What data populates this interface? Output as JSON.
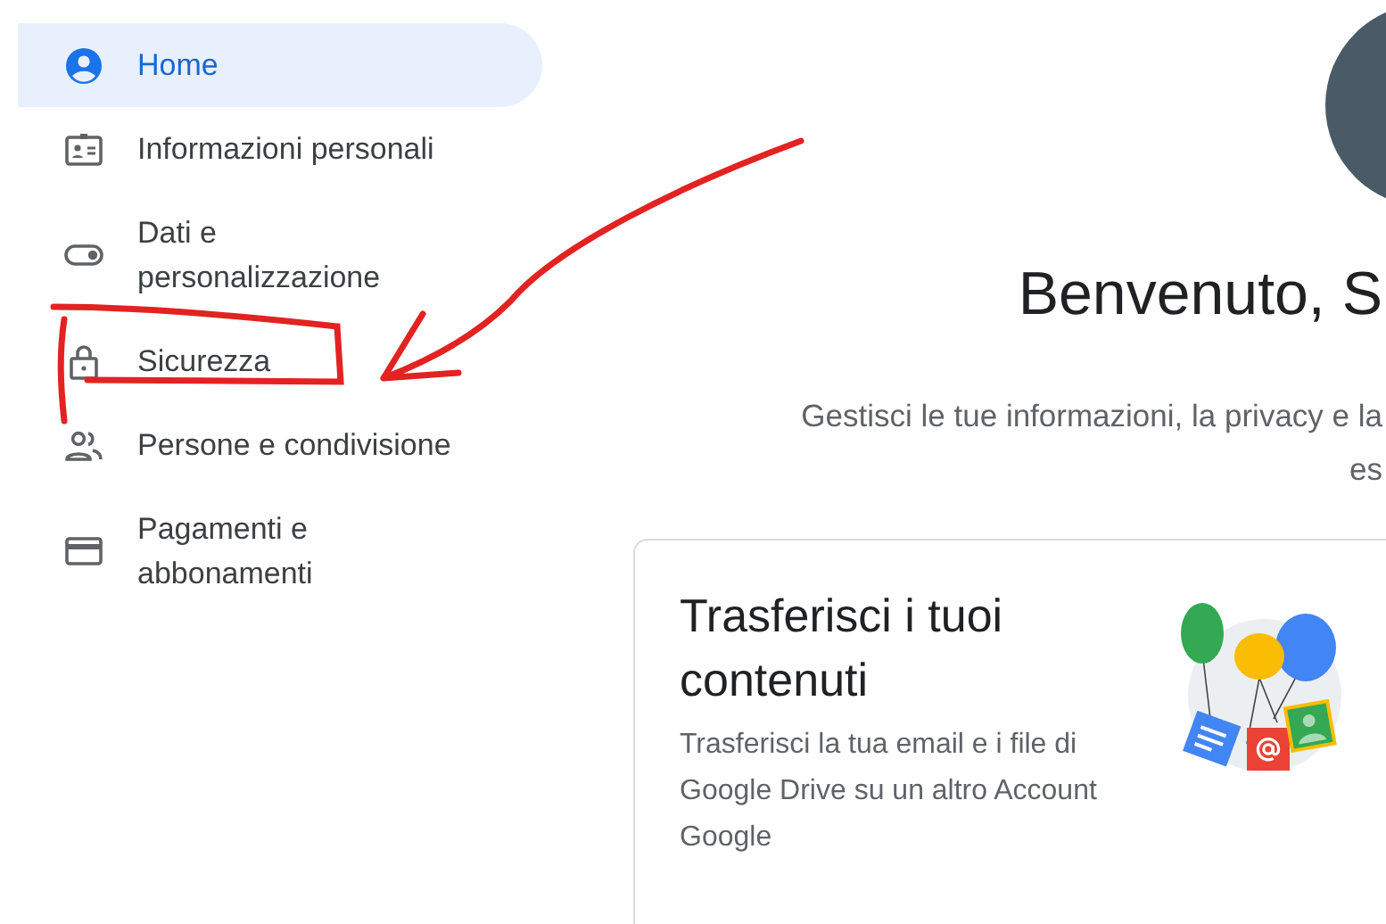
{
  "sidebar": {
    "items": [
      {
        "kind": "account",
        "label": "Home",
        "selected": true,
        "highlighted": false
      },
      {
        "kind": "badge",
        "label": "Informazioni personali",
        "selected": false,
        "highlighted": false
      },
      {
        "kind": "toggle",
        "label": "Dati e personalizzazione",
        "selected": false,
        "highlighted": false
      },
      {
        "kind": "lock",
        "label": "Sicurezza",
        "selected": false,
        "highlighted": true
      },
      {
        "kind": "people",
        "label": "Persone e condivisione",
        "selected": false,
        "highlighted": false
      },
      {
        "kind": "card",
        "label": "Pagamenti e abbonamenti",
        "selected": false,
        "highlighted": false
      }
    ]
  },
  "main": {
    "title": "Benvenuto, S",
    "subtitle": [
      "Gestisci le tue informazioni, la privacy e la",
      "es"
    ],
    "card": {
      "title": "Trasferisci i tuoi contenuti",
      "description": "Trasferisci la tua email e i file di Google Drive su un altro Account Google"
    }
  }
}
